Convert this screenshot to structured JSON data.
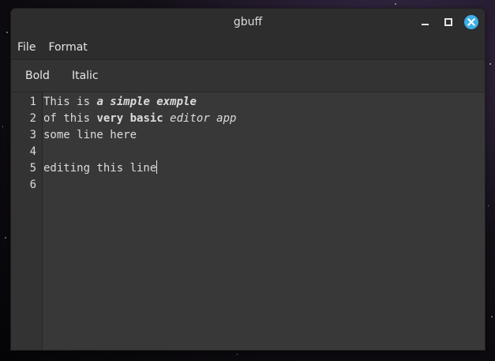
{
  "window": {
    "title": "gbuff",
    "controls": [
      "minimize-icon",
      "maximize-icon",
      "close-icon"
    ]
  },
  "menubar": {
    "items": [
      {
        "label": "File"
      },
      {
        "label": "Format"
      }
    ]
  },
  "toolbar": {
    "bold_label": "Bold",
    "italic_label": "Italic"
  },
  "editor": {
    "line_numbers": [
      "1",
      "2",
      "3",
      "4",
      "5",
      "6"
    ],
    "lines": [
      [
        {
          "text": "This is "
        },
        {
          "text": "a simple exmple",
          "bold": true,
          "italic": true
        }
      ],
      [
        {
          "text": "of this "
        },
        {
          "text": "very basic",
          "bold": true
        },
        {
          "text": " "
        },
        {
          "text": "editor app",
          "italic": true
        }
      ],
      [
        {
          "text": "some line here"
        }
      ],
      [],
      [
        {
          "text": "editing this line"
        }
      ],
      []
    ],
    "cursor_line": 5
  },
  "colors": {
    "close_button": "#3daee9",
    "window_bg": "#353535",
    "titlebar_bg": "#2d2d2d",
    "text": "#dcdcdc"
  }
}
